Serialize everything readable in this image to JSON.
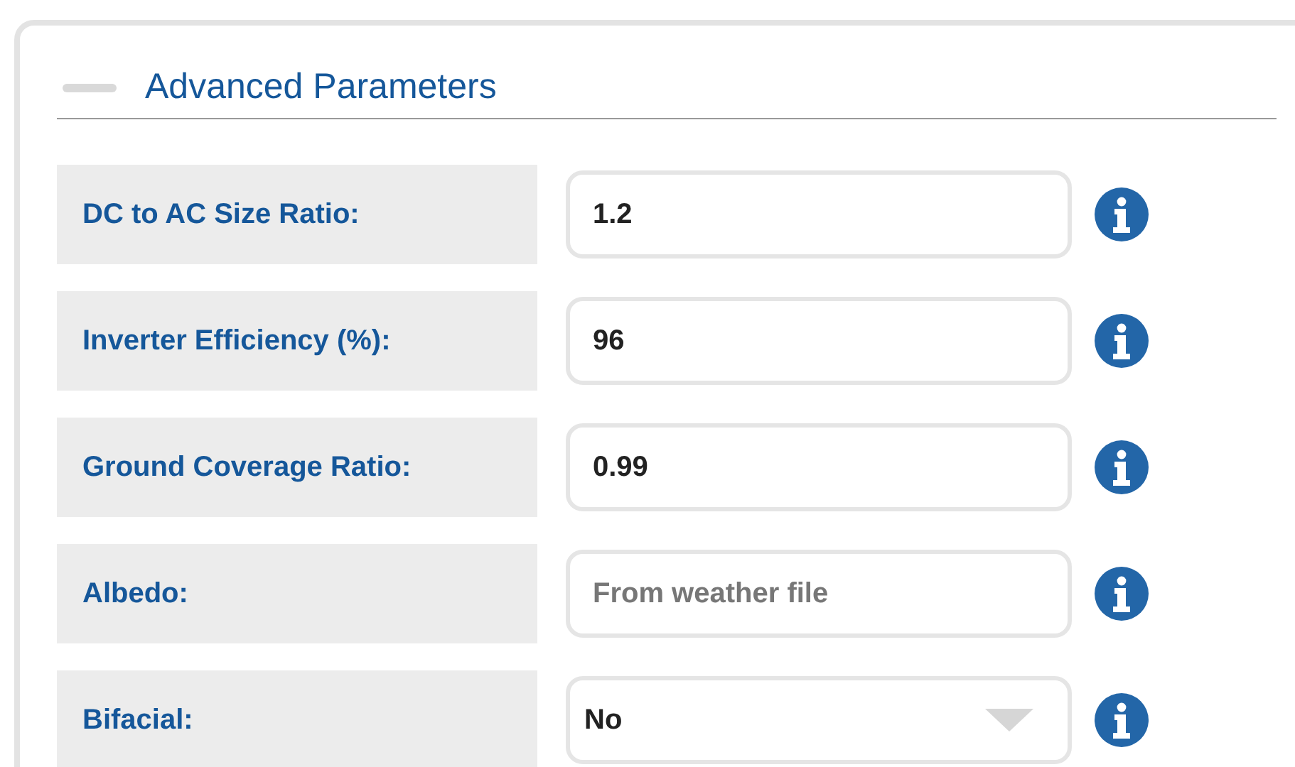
{
  "section": {
    "title": "Advanced Parameters",
    "expanded": true
  },
  "fields": [
    {
      "kind": "input",
      "label": "DC to AC Size Ratio:",
      "value": "1.2"
    },
    {
      "kind": "input",
      "label": "Inverter Efficiency (%):",
      "value": "96"
    },
    {
      "kind": "input",
      "label": "Ground Coverage Ratio:",
      "value": "0.99"
    },
    {
      "kind": "input",
      "label": "Albedo:",
      "placeholder": "From weather file"
    },
    {
      "kind": "select",
      "label": "Bifacial:",
      "value": "No"
    }
  ]
}
